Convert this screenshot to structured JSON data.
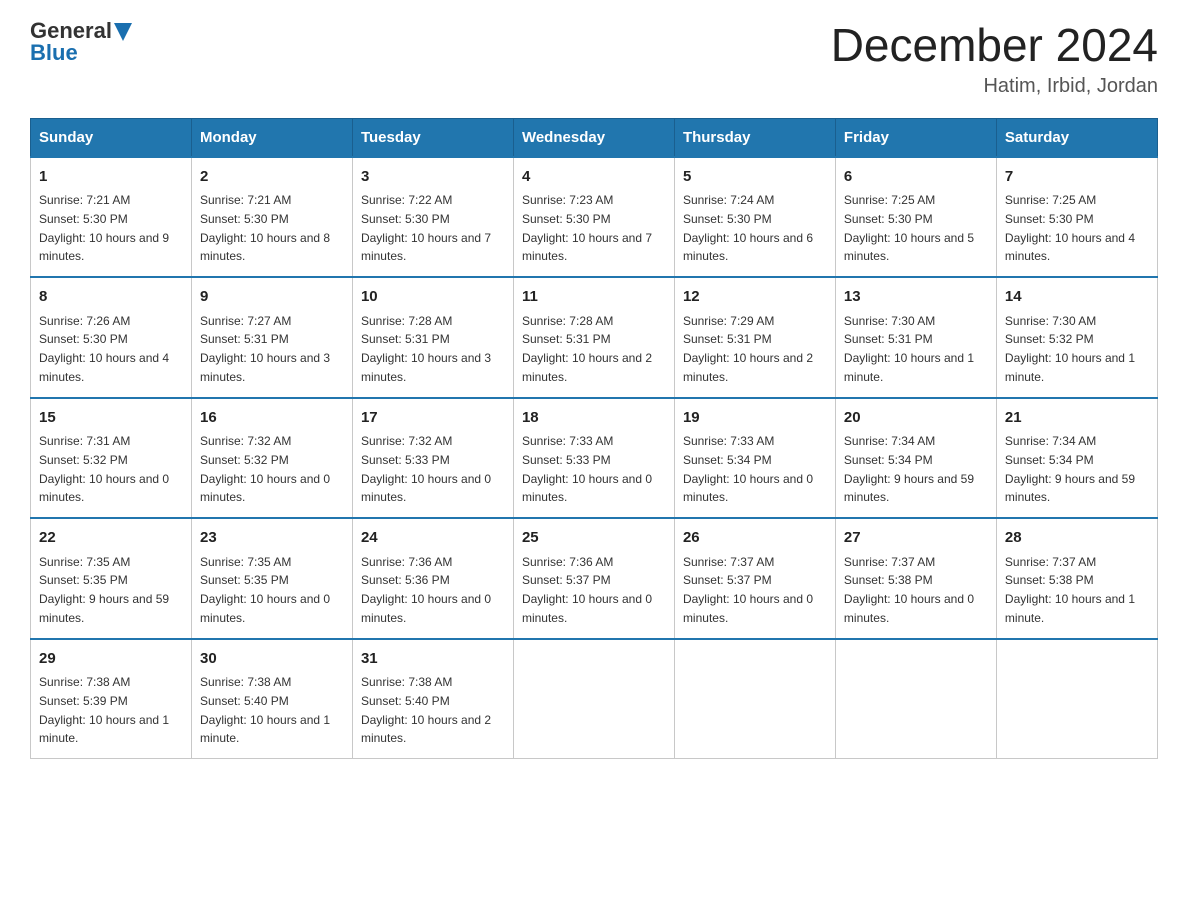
{
  "header": {
    "logo": {
      "text_general": "General",
      "text_blue": "Blue",
      "alt": "GeneralBlue logo"
    },
    "title": "December 2024",
    "location": "Hatim, Irbid, Jordan"
  },
  "days_of_week": [
    "Sunday",
    "Monday",
    "Tuesday",
    "Wednesday",
    "Thursday",
    "Friday",
    "Saturday"
  ],
  "weeks": [
    [
      {
        "day": "1",
        "sunrise": "7:21 AM",
        "sunset": "5:30 PM",
        "daylight": "10 hours and 9 minutes."
      },
      {
        "day": "2",
        "sunrise": "7:21 AM",
        "sunset": "5:30 PM",
        "daylight": "10 hours and 8 minutes."
      },
      {
        "day": "3",
        "sunrise": "7:22 AM",
        "sunset": "5:30 PM",
        "daylight": "10 hours and 7 minutes."
      },
      {
        "day": "4",
        "sunrise": "7:23 AM",
        "sunset": "5:30 PM",
        "daylight": "10 hours and 7 minutes."
      },
      {
        "day": "5",
        "sunrise": "7:24 AM",
        "sunset": "5:30 PM",
        "daylight": "10 hours and 6 minutes."
      },
      {
        "day": "6",
        "sunrise": "7:25 AM",
        "sunset": "5:30 PM",
        "daylight": "10 hours and 5 minutes."
      },
      {
        "day": "7",
        "sunrise": "7:25 AM",
        "sunset": "5:30 PM",
        "daylight": "10 hours and 4 minutes."
      }
    ],
    [
      {
        "day": "8",
        "sunrise": "7:26 AM",
        "sunset": "5:30 PM",
        "daylight": "10 hours and 4 minutes."
      },
      {
        "day": "9",
        "sunrise": "7:27 AM",
        "sunset": "5:31 PM",
        "daylight": "10 hours and 3 minutes."
      },
      {
        "day": "10",
        "sunrise": "7:28 AM",
        "sunset": "5:31 PM",
        "daylight": "10 hours and 3 minutes."
      },
      {
        "day": "11",
        "sunrise": "7:28 AM",
        "sunset": "5:31 PM",
        "daylight": "10 hours and 2 minutes."
      },
      {
        "day": "12",
        "sunrise": "7:29 AM",
        "sunset": "5:31 PM",
        "daylight": "10 hours and 2 minutes."
      },
      {
        "day": "13",
        "sunrise": "7:30 AM",
        "sunset": "5:31 PM",
        "daylight": "10 hours and 1 minute."
      },
      {
        "day": "14",
        "sunrise": "7:30 AM",
        "sunset": "5:32 PM",
        "daylight": "10 hours and 1 minute."
      }
    ],
    [
      {
        "day": "15",
        "sunrise": "7:31 AM",
        "sunset": "5:32 PM",
        "daylight": "10 hours and 0 minutes."
      },
      {
        "day": "16",
        "sunrise": "7:32 AM",
        "sunset": "5:32 PM",
        "daylight": "10 hours and 0 minutes."
      },
      {
        "day": "17",
        "sunrise": "7:32 AM",
        "sunset": "5:33 PM",
        "daylight": "10 hours and 0 minutes."
      },
      {
        "day": "18",
        "sunrise": "7:33 AM",
        "sunset": "5:33 PM",
        "daylight": "10 hours and 0 minutes."
      },
      {
        "day": "19",
        "sunrise": "7:33 AM",
        "sunset": "5:34 PM",
        "daylight": "10 hours and 0 minutes."
      },
      {
        "day": "20",
        "sunrise": "7:34 AM",
        "sunset": "5:34 PM",
        "daylight": "9 hours and 59 minutes."
      },
      {
        "day": "21",
        "sunrise": "7:34 AM",
        "sunset": "5:34 PM",
        "daylight": "9 hours and 59 minutes."
      }
    ],
    [
      {
        "day": "22",
        "sunrise": "7:35 AM",
        "sunset": "5:35 PM",
        "daylight": "9 hours and 59 minutes."
      },
      {
        "day": "23",
        "sunrise": "7:35 AM",
        "sunset": "5:35 PM",
        "daylight": "10 hours and 0 minutes."
      },
      {
        "day": "24",
        "sunrise": "7:36 AM",
        "sunset": "5:36 PM",
        "daylight": "10 hours and 0 minutes."
      },
      {
        "day": "25",
        "sunrise": "7:36 AM",
        "sunset": "5:37 PM",
        "daylight": "10 hours and 0 minutes."
      },
      {
        "day": "26",
        "sunrise": "7:37 AM",
        "sunset": "5:37 PM",
        "daylight": "10 hours and 0 minutes."
      },
      {
        "day": "27",
        "sunrise": "7:37 AM",
        "sunset": "5:38 PM",
        "daylight": "10 hours and 0 minutes."
      },
      {
        "day": "28",
        "sunrise": "7:37 AM",
        "sunset": "5:38 PM",
        "daylight": "10 hours and 1 minute."
      }
    ],
    [
      {
        "day": "29",
        "sunrise": "7:38 AM",
        "sunset": "5:39 PM",
        "daylight": "10 hours and 1 minute."
      },
      {
        "day": "30",
        "sunrise": "7:38 AM",
        "sunset": "5:40 PM",
        "daylight": "10 hours and 1 minute."
      },
      {
        "day": "31",
        "sunrise": "7:38 AM",
        "sunset": "5:40 PM",
        "daylight": "10 hours and 2 minutes."
      },
      null,
      null,
      null,
      null
    ]
  ],
  "labels": {
    "sunrise": "Sunrise:",
    "sunset": "Sunset:",
    "daylight": "Daylight:"
  }
}
